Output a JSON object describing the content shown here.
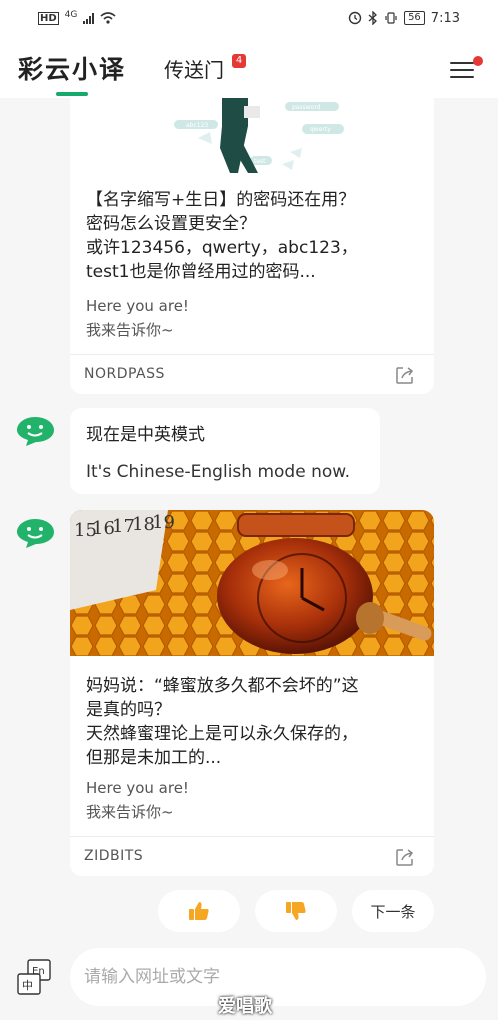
{
  "status_bar": {
    "network": "HD",
    "signal": "4G",
    "battery": "56",
    "time": "7:13"
  },
  "nav": {
    "app_tab": "彩云小译",
    "second_tab": "传送门",
    "second_tab_badge": "4"
  },
  "hero1_tags": [
    "password",
    "abc123",
    "qwerty",
    "test"
  ],
  "card1": {
    "title_lines": [
      "【名字缩写+生日】的密码还在用？",
      "密码怎么设置更安全？",
      "或许123456，qwerty，abc123，",
      "test1也是你曾经用过的密码..."
    ],
    "sub_lines": [
      "Here you are!",
      "我来告诉你~"
    ],
    "source": "NORDPASS"
  },
  "bubble": {
    "zh": "现在是中英模式",
    "en": "It's Chinese-English mode now."
  },
  "hero2_calendar": [
    "15",
    "16",
    "17",
    "18",
    "19"
  ],
  "card2": {
    "title_lines": [
      "妈妈说：“蜂蜜放多久都不会坏的”这",
      "是真的吗？",
      "天然蜂蜜理论上是可以永久保存的，",
      "但那是未加工的..."
    ],
    "sub_lines": [
      "Here you are!",
      "我来告诉你~"
    ],
    "source": "ZIDBITS"
  },
  "actions": {
    "like_icon": "thumbs-up-icon",
    "dislike_icon": "thumbs-down-icon",
    "next_label": "下一条"
  },
  "input": {
    "placeholder": "请输入网址或文字",
    "lang_top": "En",
    "lang_bottom": "中"
  },
  "watermark": "爱唱歌",
  "colors": {
    "accent": "#17a86b",
    "badge": "#e53935"
  }
}
